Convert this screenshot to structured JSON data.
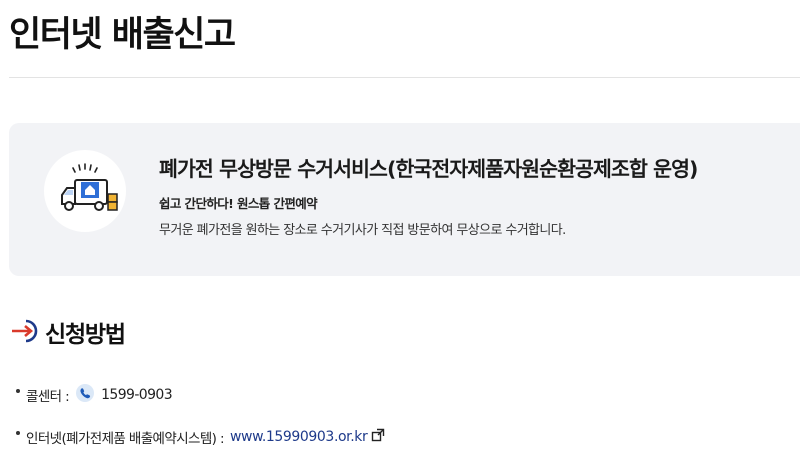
{
  "page": {
    "title": "인터넷 배출신고"
  },
  "service_box": {
    "icon": "delivery-truck-icon",
    "title": "폐가전 무상방문 수거서비스(한국전자제품자원순환공제조합 운영)",
    "subtitle": "쉽고 간단하다! 원스톱 간편예약",
    "description": "무거운 폐가전을 원하는 장소로 수거기사가 직접 방문하여 무상으로 수거합니다."
  },
  "method_section": {
    "icon": "arrow-circle-icon",
    "heading": "신청방법",
    "items": [
      {
        "label": "콜센터 :",
        "icon": "phone-icon",
        "value": "1599-0903"
      },
      {
        "label": "인터넷(폐가전제품 배출예약시스템) :",
        "link": "www.15990903.or.kr",
        "icon": "external-link-icon"
      }
    ]
  },
  "colors": {
    "accent_red": "#d93a2b",
    "accent_blue": "#1e3a8a",
    "box_bg": "#f2f3f6"
  }
}
